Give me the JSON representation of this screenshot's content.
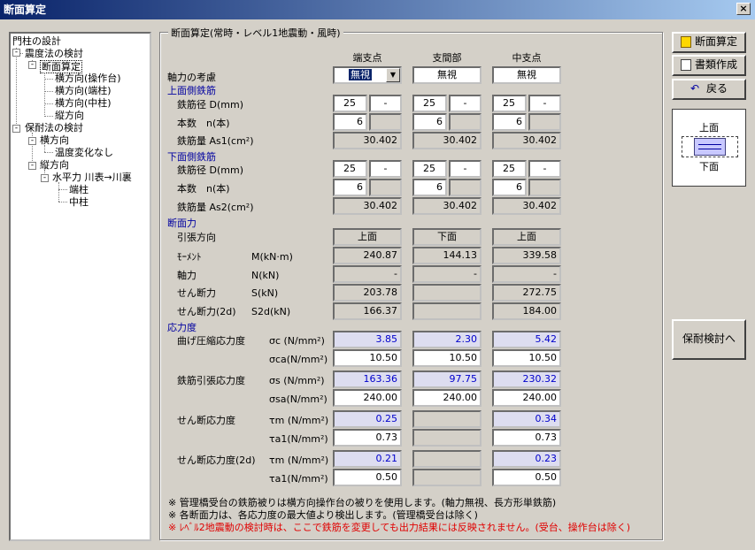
{
  "window": {
    "title": "断面算定",
    "close": "×"
  },
  "tree": {
    "n0": "門柱の設計",
    "n1": "震度法の検討",
    "n2": "断面算定",
    "n3": "横方向(操作台)",
    "n4": "横方向(端柱)",
    "n5": "横方向(中柱)",
    "n6": "縦方向",
    "n7": "保耐法の検討",
    "n8": "横方向",
    "n9": "温度変化なし",
    "n10": "縦方向",
    "n11": "水平力 川表→川裏",
    "n12": "端柱",
    "n13": "中柱",
    "minus": "-"
  },
  "panel": {
    "title": "断面算定(常時・レベル1地震動・風時)",
    "cols": [
      "端支点",
      "支間部",
      "中支点"
    ]
  },
  "axial": {
    "label": "軸力の考慮",
    "values": [
      "無視",
      "無視",
      "無視"
    ],
    "dropdown": "▼"
  },
  "upper": {
    "title": "上面側鉄筋",
    "dia_label": "鉄筋径 D(mm)",
    "count_label": "本数　n(本)",
    "area_label": "鉄筋量 As1(cm²)",
    "dia": [
      "25",
      "25",
      "25"
    ],
    "dash": "-",
    "count": [
      "6",
      "6",
      "6"
    ],
    "area": [
      "30.402",
      "30.402",
      "30.402"
    ]
  },
  "lower": {
    "title": "下面側鉄筋",
    "dia_label": "鉄筋径 D(mm)",
    "count_label": "本数　n(本)",
    "area_label": "鉄筋量 As2(cm²)",
    "dia": [
      "25",
      "25",
      "25"
    ],
    "dash": "-",
    "count": [
      "6",
      "6",
      "6"
    ],
    "area": [
      "30.402",
      "30.402",
      "30.402"
    ]
  },
  "force": {
    "title": "断面力",
    "dir_label": "引張方向",
    "dir": [
      "上面",
      "下面",
      "上面"
    ],
    "moment_label": "ﾓｰﾒﾝﾄ",
    "moment_unit": "M(kN·m)",
    "moment": [
      "240.87",
      "144.13",
      "339.58"
    ],
    "axial_label": "軸力",
    "axial_unit": "N(kN)",
    "axial": [
      "-",
      "-",
      "-"
    ],
    "shear_label": "せん断力",
    "shear_unit": "S(kN)",
    "shear": [
      "203.78",
      "",
      "272.75"
    ],
    "shear2_label": "せん断力(2d)",
    "shear2_unit": "S2d(kN)",
    "shear2": [
      "166.37",
      "",
      "184.00"
    ]
  },
  "stress": {
    "title": "応力度",
    "bend_label": "曲げ圧縮応力度",
    "sc_unit": "σc (N/mm²)",
    "sc": [
      "3.85",
      "2.30",
      "5.42"
    ],
    "sca_unit": "σca(N/mm²)",
    "sca": [
      "10.50",
      "10.50",
      "10.50"
    ],
    "tens_label": "鉄筋引張応力度",
    "ss_unit": "σs (N/mm²)",
    "ss": [
      "163.36",
      "97.75",
      "230.32"
    ],
    "ssa_unit": "σsa(N/mm²)",
    "ssa": [
      "240.00",
      "240.00",
      "240.00"
    ],
    "shear_label": "せん断応力度",
    "tm_unit": "τm (N/mm²)",
    "tm": [
      "0.25",
      "",
      "0.34"
    ],
    "ta_unit": "τa1(N/mm²)",
    "ta": [
      "0.73",
      "",
      "0.73"
    ],
    "shear2_label": "せん断応力度(2d)",
    "tm2_unit": "τm (N/mm²)",
    "tm2": [
      "0.21",
      "",
      "0.23"
    ],
    "ta2_unit": "τa1(N/mm²)",
    "ta2": [
      "0.50",
      "",
      "0.50"
    ]
  },
  "notes": [
    "※ 管理橋受台の鉄筋被りは横方向操作台の被りを使用します。(軸力無視、長方形単鉄筋)",
    "※ 各断面力は、各応力度の最大値より検出します。(管理橋受台は除く)",
    "※ ﾚﾍﾞﾙ2地震動の検討時は、ここで鉄筋を変更しても出力結果には反映されません。(受台、操作台は除く)"
  ],
  "buttons": {
    "calc": "断面算定",
    "docs": "書類作成",
    "back": "戻る",
    "hozai": "保耐検討へ"
  },
  "diagram": {
    "top": "上面",
    "bottom": "下面"
  },
  "colors": {
    "titlebar": "#0a246a",
    "note_red": "#e00000",
    "value_blue": "#0000cc"
  }
}
